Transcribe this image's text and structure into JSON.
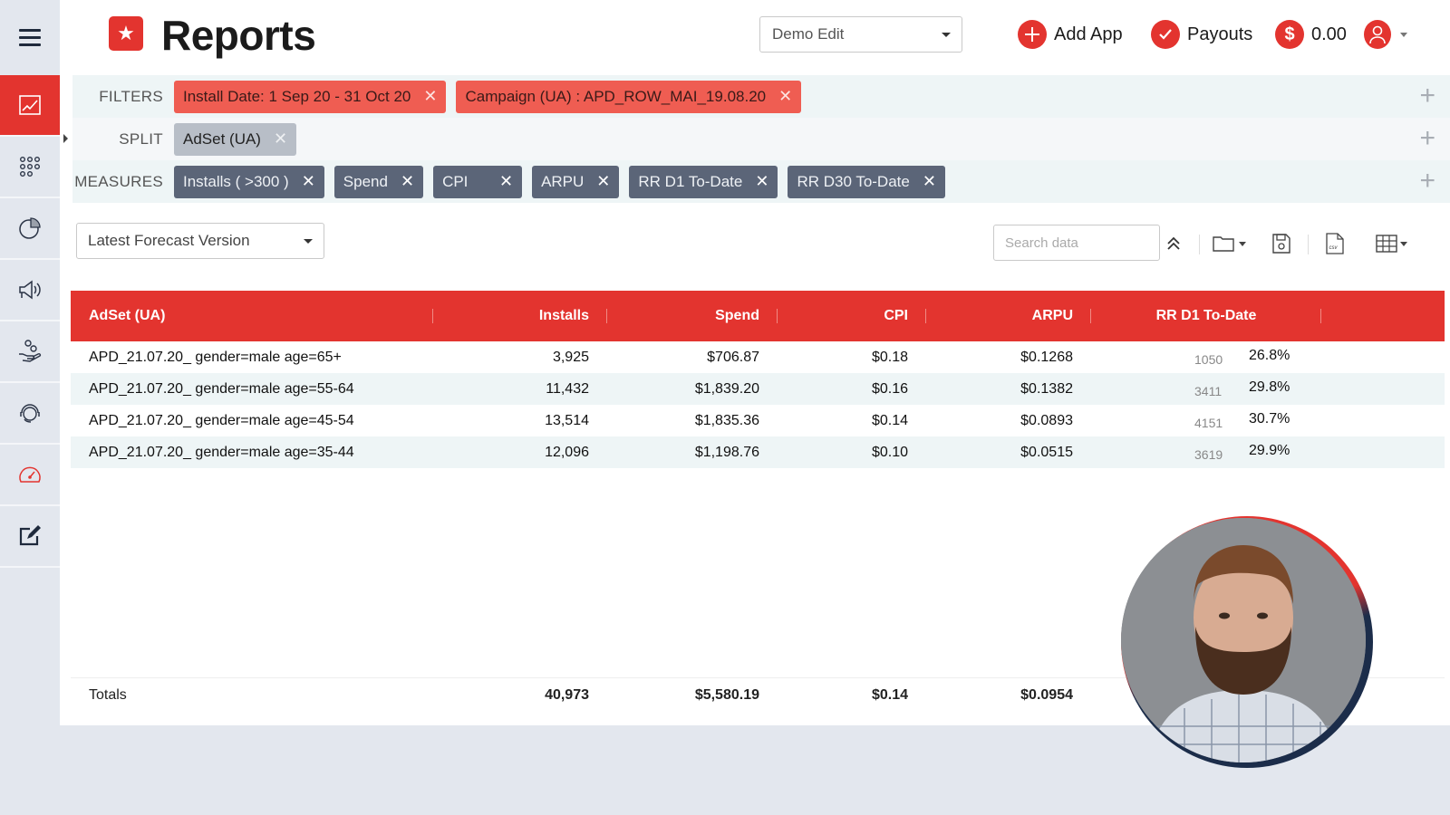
{
  "header": {
    "title": "Reports",
    "workspace_select": "Demo Edit",
    "add_app": "Add App",
    "payouts": "Payouts",
    "balance": "0.00"
  },
  "sidebar": {
    "items": [
      {
        "name": "reports",
        "icon": "line-chart-icon",
        "active": true
      },
      {
        "name": "apps",
        "icon": "grid-dots-icon"
      },
      {
        "name": "analytics",
        "icon": "pie-chart-icon"
      },
      {
        "name": "campaigns",
        "icon": "megaphone-icon"
      },
      {
        "name": "monetization",
        "icon": "hand-coins-icon"
      },
      {
        "name": "support",
        "icon": "headset-icon"
      },
      {
        "name": "performance",
        "icon": "speedometer-icon"
      },
      {
        "name": "edit",
        "icon": "edit-icon"
      }
    ]
  },
  "filters": {
    "filters_label": "FILTERS",
    "split_label": "SPLIT",
    "measures_label": "MEASURES",
    "filter_chips": [
      "Install Date: 1 Sep 20 - 31 Oct 20",
      "Campaign (UA) : APD_ROW_MAI_19.08.20"
    ],
    "split_chips": [
      "AdSet (UA)"
    ],
    "measure_chips": [
      "Installs ( >300 )",
      "Spend",
      "CPI",
      "ARPU",
      "RR D1 To-Date",
      "RR D30 To-Date"
    ],
    "remove_glyph": "✕",
    "add_glyph": "+"
  },
  "toolbar": {
    "forecast_select": "Latest Forecast Version",
    "search_placeholder": "Search data"
  },
  "table": {
    "columns": [
      "AdSet (UA)",
      "Installs",
      "Spend",
      "CPI",
      "ARPU",
      "RR D1 To-Date"
    ],
    "rows": [
      {
        "adset": "APD_21.07.20_ gender=male age=65+",
        "installs": "3,925",
        "spend": "$706.87",
        "cpi": "$0.18",
        "arpu": "$0.1268",
        "rr_count": "1050",
        "rr_pct": "26.8%"
      },
      {
        "adset": "APD_21.07.20_ gender=male age=55-64",
        "installs": "11,432",
        "spend": "$1,839.20",
        "cpi": "$0.16",
        "arpu": "$0.1382",
        "rr_count": "3411",
        "rr_pct": "29.8%"
      },
      {
        "adset": "APD_21.07.20_ gender=male age=45-54",
        "installs": "13,514",
        "spend": "$1,835.36",
        "cpi": "$0.14",
        "arpu": "$0.0893",
        "rr_count": "4151",
        "rr_pct": "30.7%"
      },
      {
        "adset": "APD_21.07.20_ gender=male age=35-44",
        "installs": "12,096",
        "spend": "$1,198.76",
        "cpi": "$0.10",
        "arpu": "$0.0515",
        "rr_count": "3619",
        "rr_pct": "29.9%"
      }
    ],
    "totals": {
      "label": "Totals",
      "installs": "40,973",
      "spend": "$5,580.19",
      "cpi": "$0.14",
      "arpu": "$0.0954"
    }
  },
  "colors": {
    "accent": "#e3342f",
    "filter_chip": "#ef5d52",
    "split_chip": "#b8bec7",
    "measure_chip": "#5b6578"
  }
}
